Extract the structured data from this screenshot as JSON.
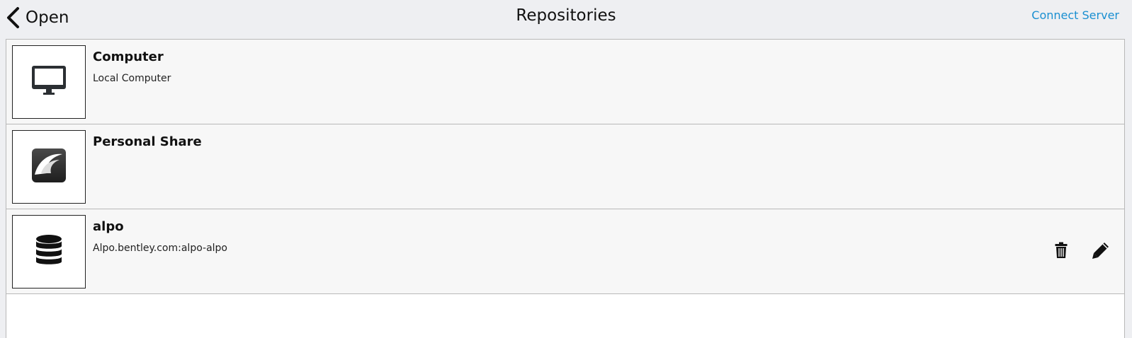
{
  "header": {
    "back_label": "Open",
    "title": "Repositories",
    "connect_label": "Connect Server"
  },
  "repositories": [
    {
      "name": "Computer",
      "subtitle": "Local Computer",
      "icon": "monitor-icon"
    },
    {
      "name": "Personal Share",
      "subtitle": "",
      "icon": "personal-share-icon"
    },
    {
      "name": "alpo",
      "subtitle": "Alpo.bentley.com:alpo-alpo",
      "icon": "database-icon",
      "actions": [
        "trash-icon",
        "pencil-icon"
      ]
    }
  ],
  "colors": {
    "accent": "#1a8fd1",
    "header_bg": "#eeeff2",
    "row_bg": "#f7f7f7"
  }
}
